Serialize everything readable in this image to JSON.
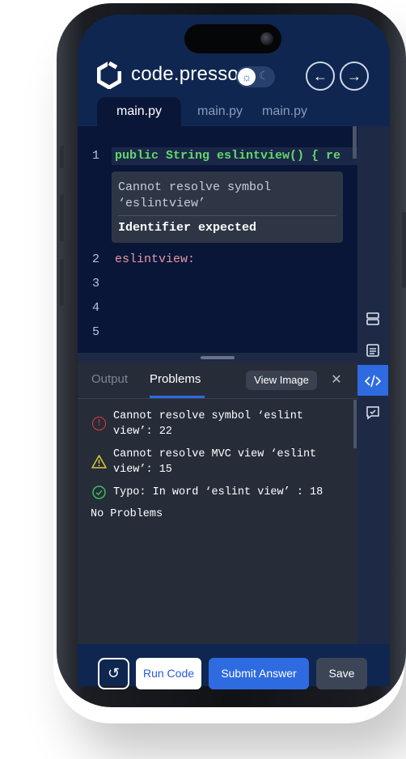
{
  "app": {
    "brand": "code.presso"
  },
  "header": {
    "back_icon": "arrow-left-icon",
    "forward_icon": "arrow-right-icon",
    "theme_icons": [
      "sun-icon",
      "moon-icon"
    ]
  },
  "tabs": [
    {
      "label": "main.py",
      "active": true
    },
    {
      "label": "main.py",
      "active": false
    },
    {
      "label": "main.py",
      "active": false
    }
  ],
  "editor": {
    "line_numbers": [
      "1",
      "2",
      "3",
      "4",
      "5"
    ],
    "line1": "public String eslintview() { re",
    "line2": "eslintview:",
    "tooltip": {
      "message": "Cannot resolve symbol ‘eslintview’",
      "detail": "Identifier expected"
    }
  },
  "sidebar_icons": [
    "layout-rows-icon",
    "document-icon",
    "code-icon",
    "chat-check-icon"
  ],
  "panel": {
    "tabs": [
      "Output",
      "Problems"
    ],
    "active_tab": "Problems",
    "view_image_label": "View Image",
    "close_icon": "close-icon",
    "problems": [
      {
        "type": "error",
        "line1": "Cannot resolve symbol ‘eslint",
        "line2": "view’: 22",
        "color": "#e03c3c"
      },
      {
        "type": "warning",
        "line1": "Cannot resolve MVC view ‘eslint",
        "line2": "view’: 15",
        "color": "#d8c93a"
      },
      {
        "type": "ok",
        "line1": "Typo: In word ‘eslint view’ : 18",
        "line2": "",
        "color": "#3cbf5a"
      }
    ],
    "empty_message": "No Problems"
  },
  "footer": {
    "undo_icon": "undo-icon",
    "run_label": "Run Code",
    "submit_label": "Submit Answer",
    "save_label": "Save"
  },
  "colors": {
    "brand_blue": "#2f6be0",
    "navy": "#0f2650",
    "editor_bg": "#0a1638",
    "keyword_green": "#62d86a",
    "variable_pink": "#e49aa6"
  }
}
